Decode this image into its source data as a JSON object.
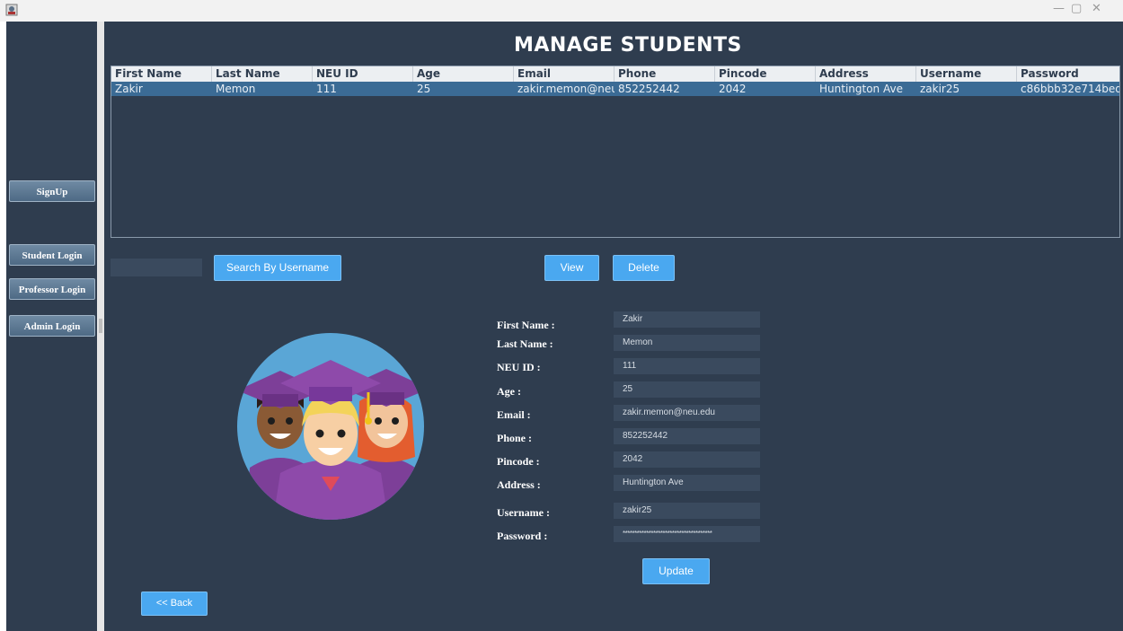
{
  "window": {
    "minimize_glyph": "—",
    "restore_glyph": "▢",
    "close_glyph": "✕"
  },
  "sidebar": {
    "signup": "SignUp",
    "student_login": "Student Login",
    "professor_login": "Professor Login",
    "admin_login": "Admin Login"
  },
  "page": {
    "title": "MANAGE STUDENTS"
  },
  "table": {
    "columns": [
      "First Name",
      "Last Name",
      "NEU ID",
      "Age",
      "Email",
      "Phone",
      "Pincode",
      "Address",
      "Username",
      "Password"
    ],
    "rows": [
      [
        "Zakir",
        "Memon",
        "111",
        "25",
        "zakir.memon@neu...",
        "852252442",
        "2042",
        "Huntington Ave",
        "zakir25",
        "c86bbb32e714bed..."
      ]
    ]
  },
  "actions": {
    "search_value": "",
    "search_button": "Search By Username",
    "view_button": "View",
    "delete_button": "Delete",
    "update_button": "Update",
    "back_button": "<< Back"
  },
  "form": {
    "labels": {
      "first_name": "First Name :",
      "last_name": "Last Name :",
      "neu_id": "NEU ID :",
      "age": "Age :",
      "email": "Email :",
      "phone": "Phone :",
      "pincode": "Pincode :",
      "address": "Address :",
      "username": "Username :",
      "password": "Password :"
    },
    "values": {
      "first_name": "Zakir",
      "last_name": "Memon",
      "neu_id": "111",
      "age": "25",
      "email": "zakir.memon@neu.edu",
      "phone": "852252442",
      "pincode": "2042",
      "address": "Huntington Ave",
      "username": "zakir25",
      "password": "**************************************"
    }
  },
  "icons": {
    "avatar": "graduates-illustration-icon",
    "app": "java-app-icon"
  },
  "colors": {
    "background": "#2f3d4f",
    "accent": "#4aa8f0",
    "row_selected": "#3b6b95"
  }
}
